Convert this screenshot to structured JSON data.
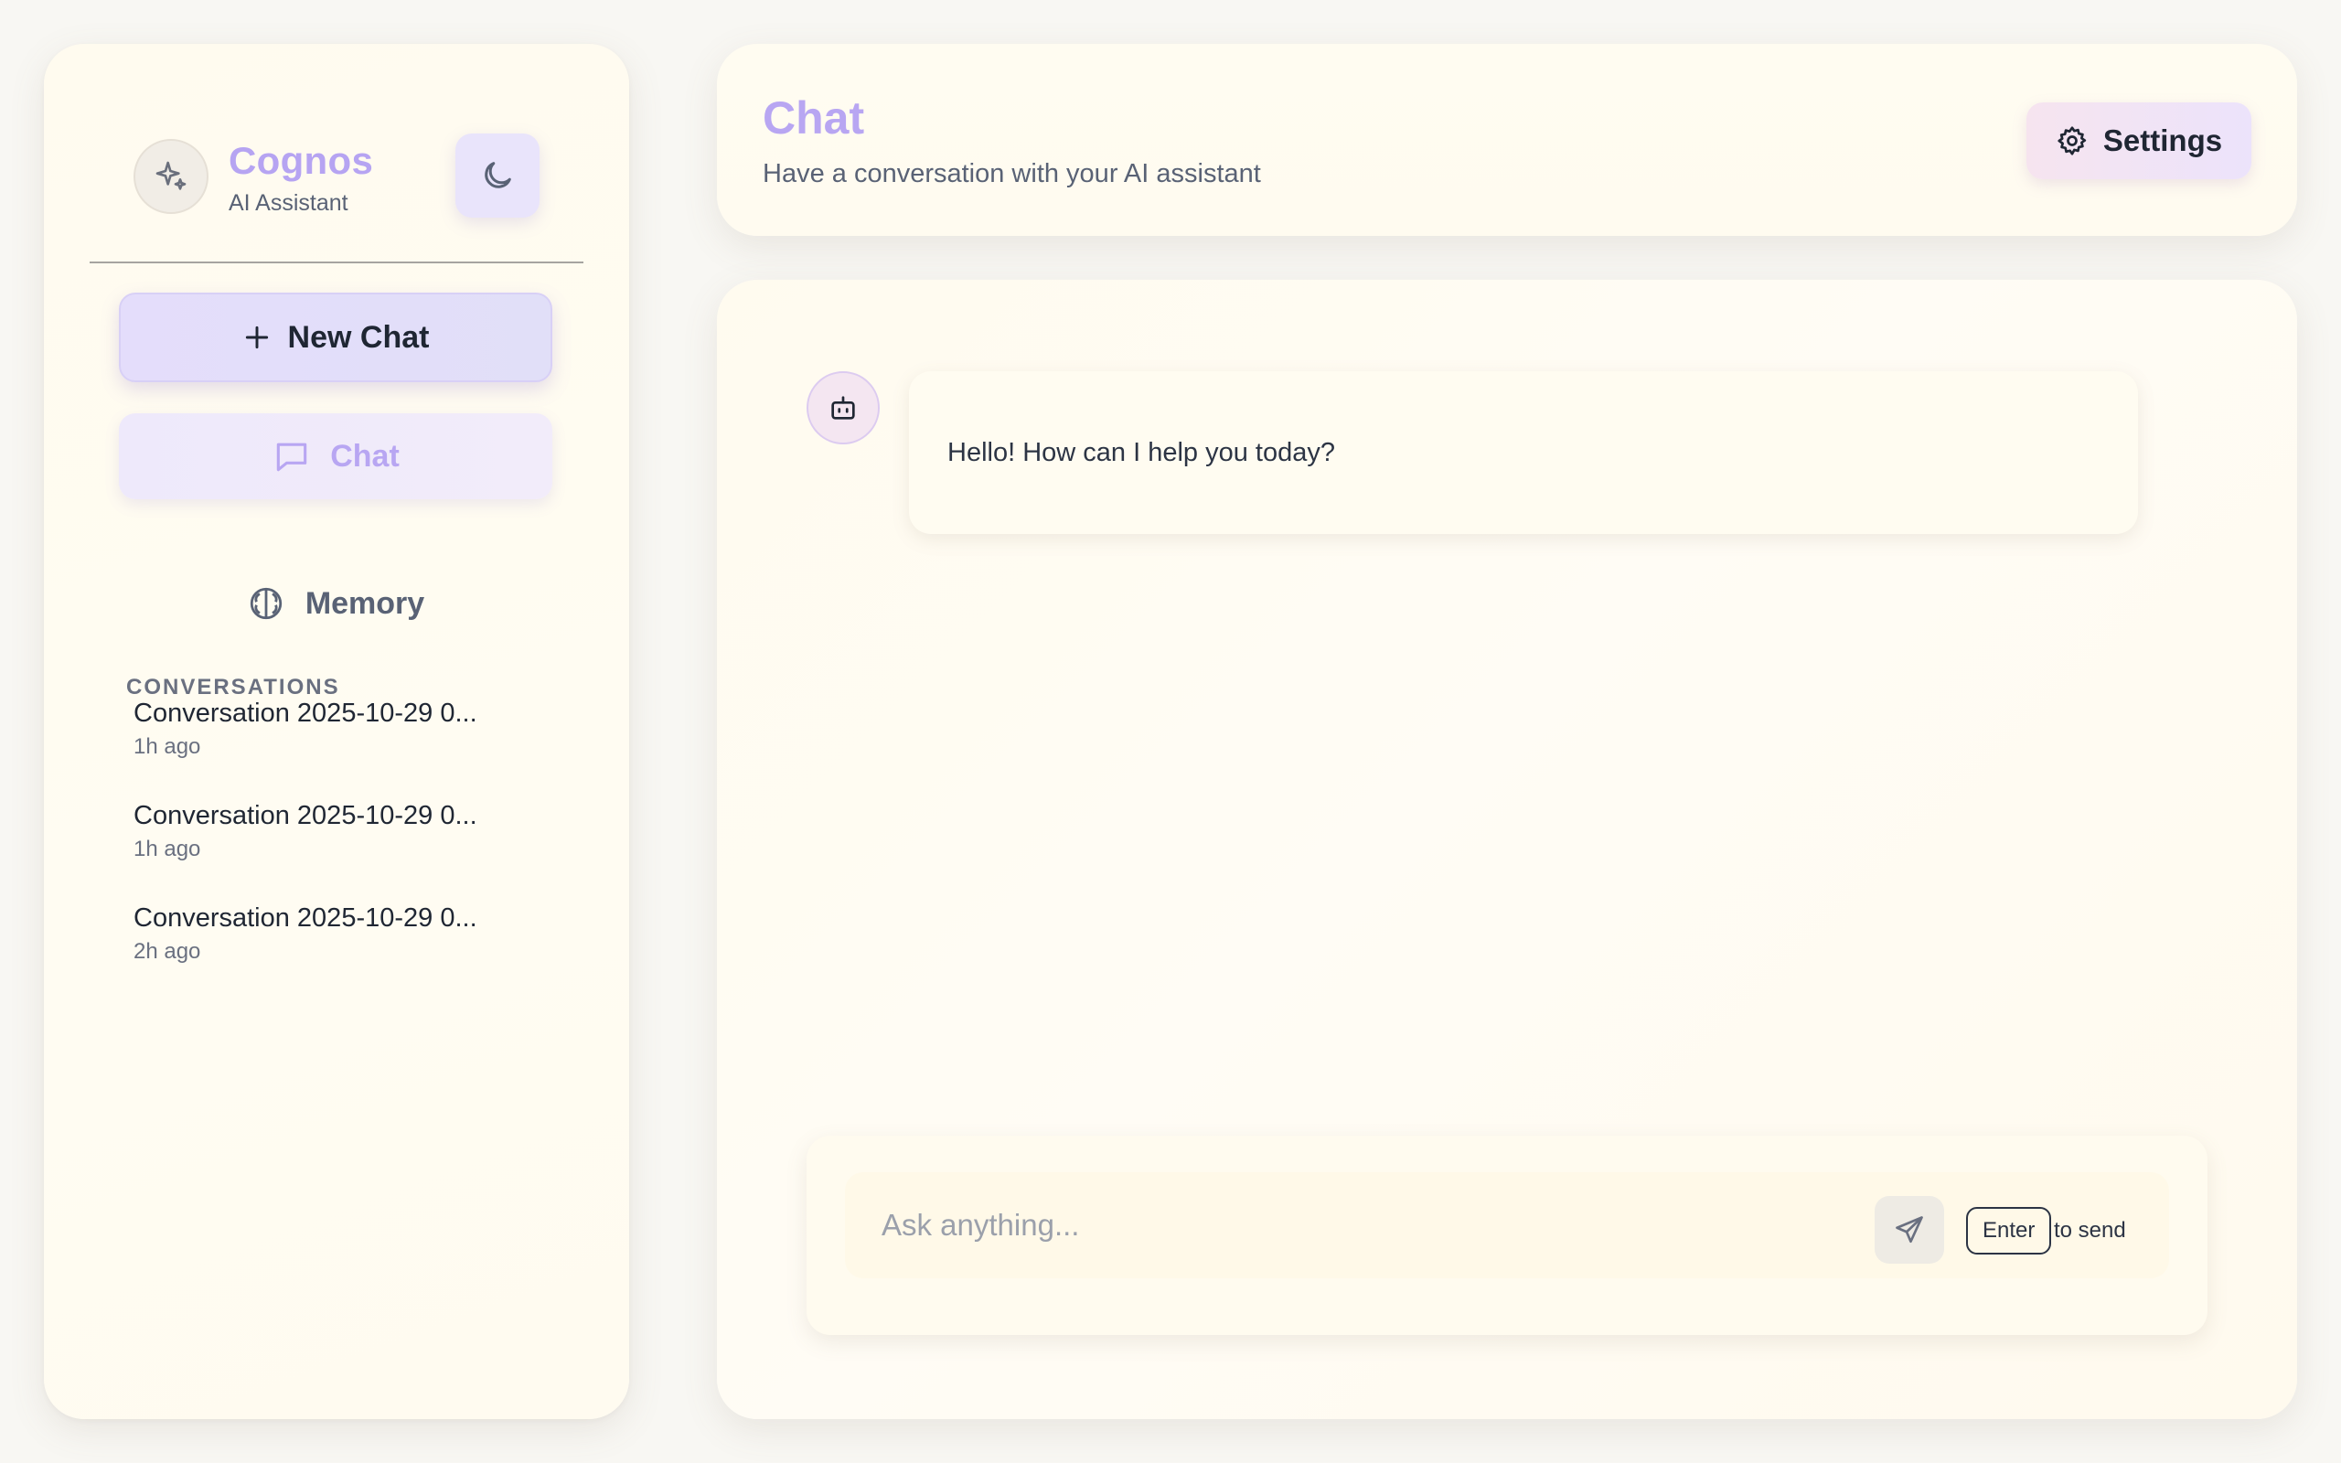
{
  "brand": {
    "title": "Cognos",
    "subtitle": "AI Assistant",
    "icon": "sparkles-icon"
  },
  "theme_toggle": {
    "icon": "moon-icon"
  },
  "sidebar": {
    "new_chat_label": "New Chat",
    "nav": [
      {
        "label": "Chat",
        "icon": "message-square-icon",
        "active": true
      },
      {
        "label": "Memory",
        "icon": "brain-icon",
        "active": false
      }
    ],
    "section_label": "CONVERSATIONS",
    "conversations": [
      {
        "title": "Conversation 2025-10-29 0...",
        "time": "1h ago"
      },
      {
        "title": "Conversation 2025-10-29 0...",
        "time": "1h ago"
      },
      {
        "title": "Conversation 2025-10-29 0...",
        "time": "2h ago"
      }
    ]
  },
  "header": {
    "title": "Chat",
    "subtitle": "Have a conversation with your AI assistant",
    "settings_label": "Settings"
  },
  "messages": [
    {
      "role": "assistant",
      "text": "Hello! How can I help you today?"
    }
  ],
  "composer": {
    "placeholder": "Ask anything...",
    "hint_key": "Enter",
    "hint_text": "to send"
  },
  "colors": {
    "accent": "#b8a6f2",
    "background": "#f8f7f3",
    "panel": "#fffbef",
    "text": "#1f2633",
    "muted": "#596275"
  }
}
